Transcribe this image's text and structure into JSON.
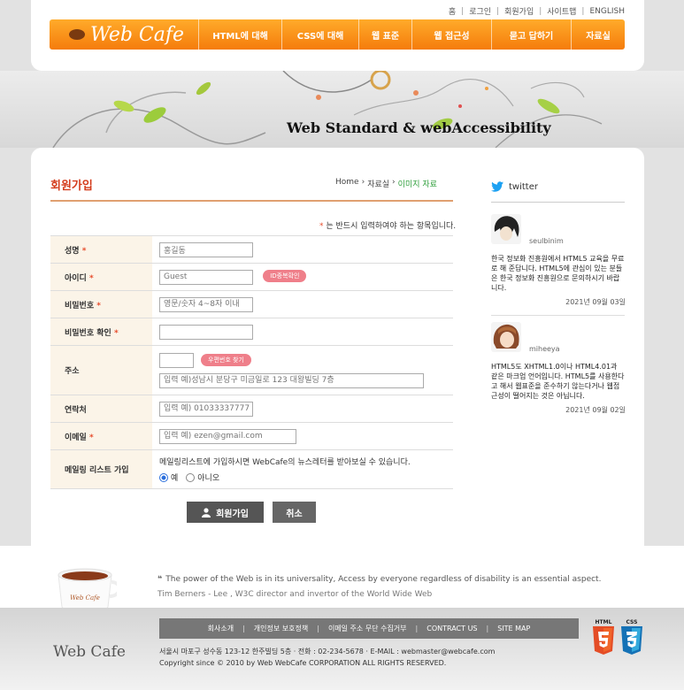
{
  "util_nav": [
    "홈",
    "로그인",
    "회원가입",
    "사이트맵",
    "ENGLISH"
  ],
  "logo": "Web Cafe",
  "gnb": [
    "HTML에 대해",
    "CSS에 대해",
    "웹 표준",
    "웹 접근성",
    "묻고 답하기",
    "자료실"
  ],
  "visual_title": "Web Standard & webAccessibility",
  "page_title": "회원가입",
  "breadcrumb": {
    "home": "Home",
    "section": "자료실",
    "current": "이미지 자료"
  },
  "required_note": "는 반드시 입력하여야 하는 항목입니다.",
  "form": {
    "name": {
      "label": "성명",
      "value": "홍길동"
    },
    "id": {
      "label": "아이디",
      "value": "Guest",
      "button": "ID중복확인"
    },
    "password": {
      "label": "비밀번호",
      "placeholder": "영문/숫자 4~8자 이내"
    },
    "password_confirm": {
      "label": "비밀번호 확인"
    },
    "address": {
      "label": "주소",
      "zip_button": "우편번호 찾기",
      "placeholder": "입력 예)성남시 분당구 미금일로 123 대왕빌딩 7층"
    },
    "phone": {
      "label": "연락처",
      "placeholder": "입력 예) 01033337777"
    },
    "email": {
      "label": "이메일",
      "placeholder": "입력 예) ezen@gmail.com"
    },
    "mailing": {
      "label": "메일링 리스트 가입",
      "text": "메일링리스트에 가입하시면 WebCafe의 뉴스레터를 받아보실 수 있습니다.",
      "yes": "예",
      "no": "아니오"
    }
  },
  "buttons": {
    "join": "회원가입",
    "cancel": "취소"
  },
  "twitter": {
    "title": "twitter",
    "posts": [
      {
        "user": "seulbinim",
        "text": "한국 정보화 진흥원에서 HTML5 교육을 무료로 해 준답니다. HTML5에 관심이 있는 분들은 한국 정보화 진흥원으로 문의하시기 바랍니다.",
        "date": "2021년 09월 03일"
      },
      {
        "user": "miheeya",
        "text": "HTML5도 XHTML1.0이나 HTML4.01과 같은 마크업 언어입니다. HTML5를 사용한다고 해서 웹표준을 준수하기 않는다거나 웹접근성이 떨어지는 것은 아닙니다.",
        "date": "2021년 09월 02일"
      }
    ]
  },
  "quote": {
    "text": "The power of the Web is in its universality, Access by everyone regardless of disability is an essential aspect.",
    "source": "Tim Berners - Lee , W3C director and invertor of the World Wide Web"
  },
  "cup_label": "Web Cafe",
  "footer": {
    "logo": "Web Cafe",
    "nav": [
      "회사소개",
      "개인정보 보호정책",
      "이메일 주소 무단 수집거부",
      "CONTRACT US",
      "SITE MAP"
    ],
    "address": "서울시 마포구 성수동 123-12 한주빌딩 5층  · 전화 : 02-234-5678   · E-MAIL : webmaster@webcafe.com",
    "copyright": "Copyright since © 2010 by Web WebCafe CORPORATION ALL RIGHTS RESERVED.",
    "badges": [
      "HTML",
      "CSS"
    ]
  },
  "colors": {
    "orange": "#f57c0c",
    "title_red": "#d43c1c",
    "html5": "#e44d26",
    "css3": "#1572b6",
    "twitter": "#1da1f2"
  }
}
